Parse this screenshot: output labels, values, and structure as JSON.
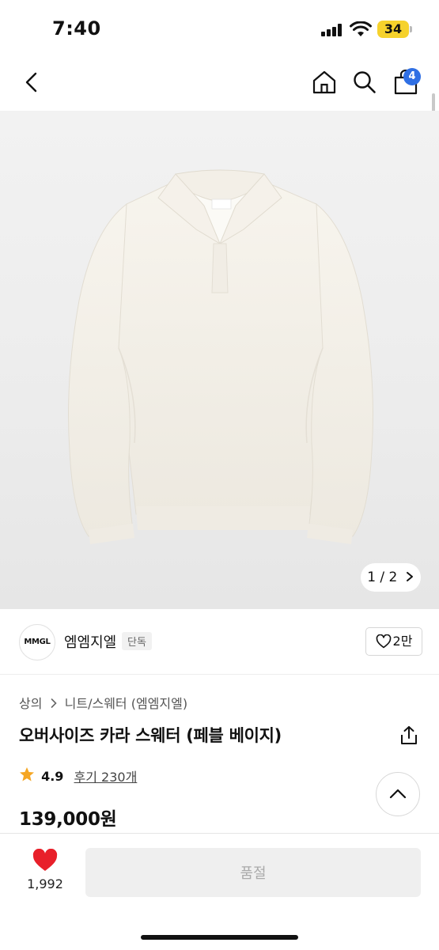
{
  "status_bar": {
    "time": "7:40",
    "battery": "34",
    "icons": [
      "signal-icon",
      "wifi-icon",
      "battery-icon"
    ]
  },
  "nav": {
    "icons": [
      "back-icon",
      "home-icon",
      "search-icon",
      "cart-icon"
    ],
    "cart_count": "4"
  },
  "gallery": {
    "counter": "1 / 2",
    "next_icon": "chevron-right-icon"
  },
  "brand": {
    "logo_text": "MMGL",
    "name": "엠엠지엘",
    "tag": "단독",
    "like_count": "2만"
  },
  "product": {
    "breadcrumb": [
      "상의",
      "니트/스웨터 (엠엠지엘)"
    ],
    "title": "오버사이즈 카라 스웨터 (페블 베이지)",
    "rating": "4.9",
    "review_text": "후기 230개",
    "price": "139,000원"
  },
  "bottom_bar": {
    "wish_count": "1,992",
    "soldout_label": "품절"
  },
  "colors": {
    "accent_badge": "#2f6fe4",
    "heart": "#e8202a",
    "star": "#f5a623",
    "battery": "#f6d22c"
  }
}
